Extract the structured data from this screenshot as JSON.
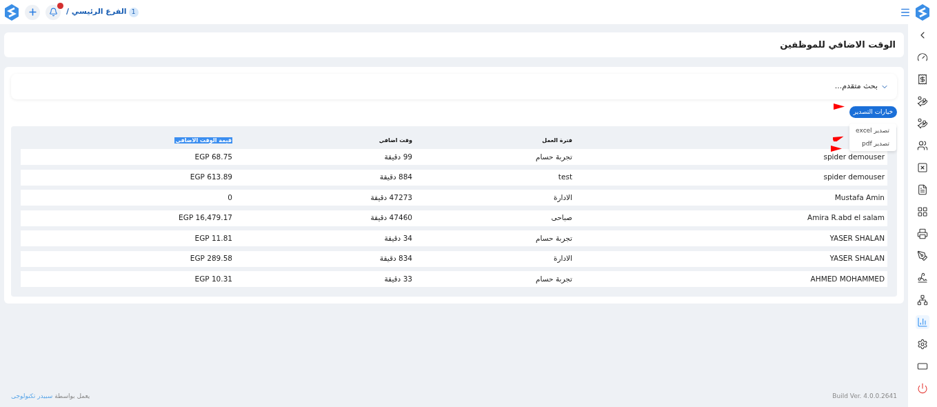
{
  "topbar": {
    "branch_count": "1",
    "branch": "الفرع الرئيسي /",
    "notifications_badge": true
  },
  "sidebar": {
    "items": [
      {
        "selected": false
      },
      {
        "selected": false
      },
      {
        "selected": false
      },
      {
        "selected": false
      },
      {
        "selected": false
      },
      {
        "selected": false
      },
      {
        "selected": false
      },
      {
        "selected": false
      },
      {
        "selected": false
      },
      {
        "selected": false
      },
      {
        "selected": false
      },
      {
        "selected": false
      },
      {
        "selected": false
      },
      {
        "selected": true
      },
      {
        "selected": false
      },
      {
        "selected": false
      },
      {
        "selected": false
      }
    ]
  },
  "page_title": "الوقت الاضافي للموظفين",
  "advanced_search": {
    "label": "بحث متقدم...",
    "expanded": false
  },
  "export": {
    "button": "خيارات التصدير",
    "menu": [
      "تصدير excel",
      "تصدير pdf"
    ]
  },
  "table": {
    "headers_after_first": [
      {
        "label": "فترة العمل",
        "highlighted": false
      },
      {
        "label": "وقت اضافي",
        "highlighted": false
      },
      {
        "label": "قيمة الوقت الاضافي",
        "highlighted": true
      }
    ],
    "rows": [
      [
        "spider demouser",
        "تجربة حسام",
        "99 دقيقة",
        "EGP 68.75"
      ],
      [
        "spider demouser",
        "test",
        "884 دقيقة",
        "EGP 613.89"
      ],
      [
        "Mustafa Amin",
        "الادارة",
        "47273 دقيقة",
        "0"
      ],
      [
        "Amira R.abd el salam",
        "صباحى",
        "47460 دقيقة",
        "EGP 16,479.17"
      ],
      [
        "YASER SHALAN",
        "تجربة حسام",
        "34 دقيقة",
        "EGP 11.81"
      ],
      [
        "YASER SHALAN",
        "الادارة",
        "834 دقيقة",
        "EGP 289.58"
      ],
      [
        "AHMED MOHAMMED",
        "تجربة حسام",
        "33 دقيقة",
        "EGP 10.31"
      ]
    ]
  },
  "footer": {
    "build": "Build Ver. 4.0.0.2641",
    "powered_by": "يعمل بواسطة",
    "company": "سبيدر تكنولوجى"
  }
}
